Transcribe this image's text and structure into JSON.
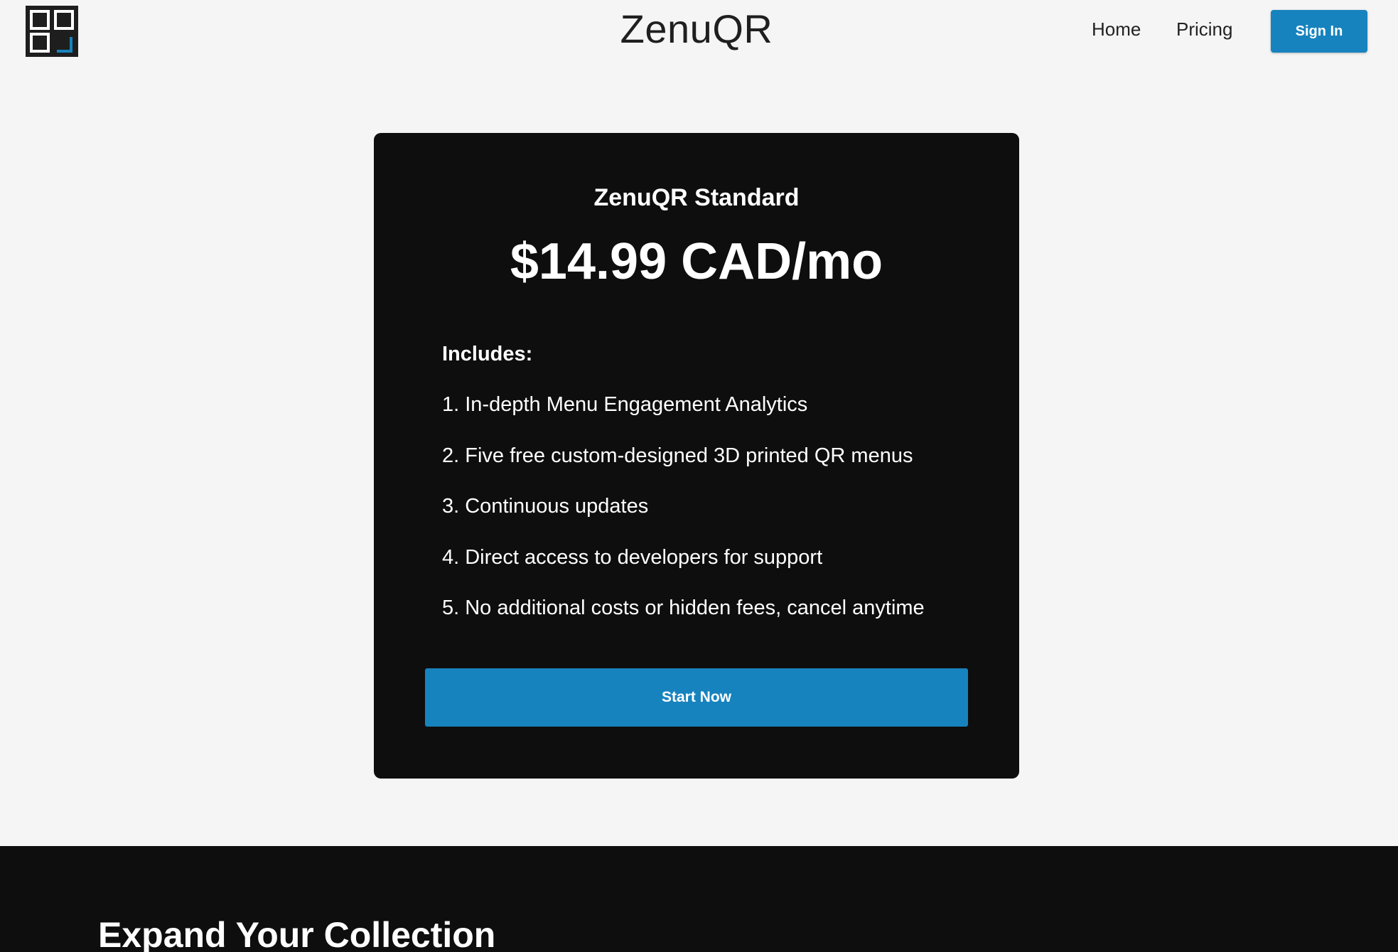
{
  "header": {
    "logo_icon": "qr-code-logo-icon",
    "title": "ZenuQR",
    "nav": {
      "home": "Home",
      "pricing": "Pricing"
    },
    "sign_in_label": "Sign In"
  },
  "plan": {
    "name": "ZenuQR Standard",
    "price": "$14.99 CAD/mo",
    "includes_label": "Includes:",
    "features": [
      "1. In-depth Menu Engagement Analytics",
      "2. Five free custom-designed 3D printed QR menus",
      "3. Continuous updates",
      "4. Direct access to developers for support",
      "5. No additional costs or hidden fees, cancel anytime"
    ],
    "cta_label": "Start Now"
  },
  "bottom": {
    "title": "Expand Your Collection"
  },
  "colors": {
    "accent": "#1783be",
    "card_background": "#0e0e0e",
    "page_background": "#f5f5f5"
  }
}
